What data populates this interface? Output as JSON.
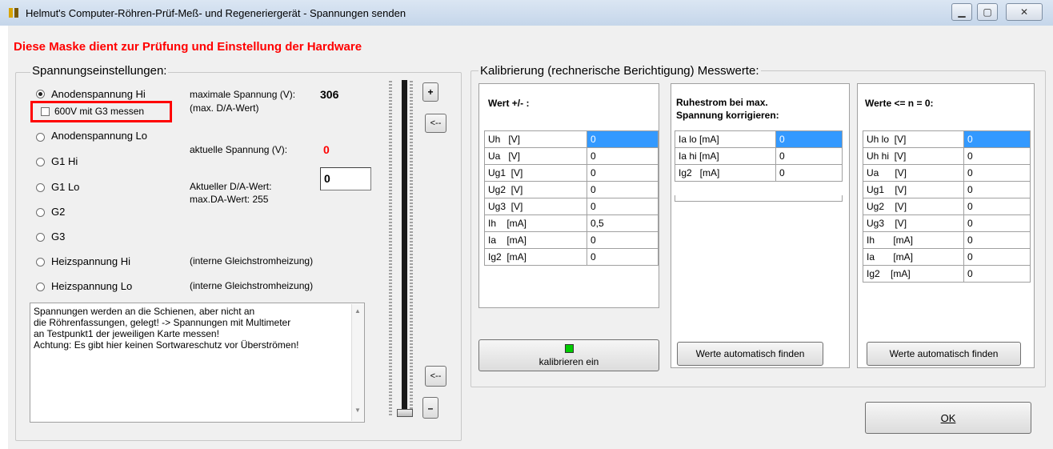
{
  "window": {
    "title": "Helmut's Computer-Röhren-Prüf-Meß- und Regeneriergerät - Spannungen senden",
    "banner": "Diese Maske dient zur Prüfung und Einstellung der Hardware"
  },
  "voltages": {
    "group_title": "Spannungseinstellungen:",
    "options": [
      {
        "label": "Anodenspannung Hi",
        "selected": true
      },
      {
        "label": "Anodenspannung Lo",
        "selected": false
      },
      {
        "label": "G1 Hi",
        "selected": false
      },
      {
        "label": "G1 Lo",
        "selected": false
      },
      {
        "label": "G2",
        "selected": false
      },
      {
        "label": "G3",
        "selected": false
      },
      {
        "label": "Heizspannung Hi",
        "selected": false
      },
      {
        "label": "Heizspannung Lo",
        "selected": false
      }
    ],
    "checkbox_600v": "600V mit G3 messen",
    "max_voltage_label": "maximale Spannung (V):",
    "max_voltage_value": "306",
    "max_da_hint": "(max. D/A-Wert)",
    "current_voltage_label": "aktuelle Spannung (V):",
    "current_voltage_value": "0",
    "current_da_label": "Aktueller D/A-Wert:",
    "current_da_value": "0",
    "max_da_label": "max.DA-Wert: 255",
    "heating_note_hi": "(interne Gleichstromheizung)",
    "heating_note_lo": "(interne Gleichstromheizung)",
    "info_text": [
      "Spannungen werden an die Schienen, aber nicht an",
      "die Röhrenfassungen, gelegt! -> Spannungen mit Multimeter",
      "an Testpunkt1 der jeweiligen Karte messen!",
      "Achtung: Es gibt hier keinen Sortwareschutz vor Überströmen!"
    ],
    "btn_plus": "+",
    "btn_minus": "–",
    "btn_back": "<--",
    "slider_level": 0
  },
  "calibration": {
    "group_title": "Kalibrierung (rechnerische Berichtigung) Messwerte:",
    "panel1": {
      "header": "Wert +/- :",
      "rows": [
        {
          "label": "Uh   [V]",
          "value": "0"
        },
        {
          "label": "Ua   [V]",
          "value": "0"
        },
        {
          "label": "Ug1  [V]",
          "value": "0"
        },
        {
          "label": "Ug2  [V]",
          "value": "0"
        },
        {
          "label": "Ug3  [V]",
          "value": "0"
        },
        {
          "label": "Ih    [mA]",
          "value": "0,5"
        },
        {
          "label": "Ia    [mA]",
          "value": "0"
        },
        {
          "label": "Ig2  [mA]",
          "value": "0"
        }
      ],
      "button": "kalibrieren ein",
      "indicator_color": "#00cc00"
    },
    "panel2": {
      "header_line1": "Ruhestrom bei max.",
      "header_line2": "Spannung korrigieren:",
      "rows": [
        {
          "label": "Ia lo [mA]",
          "value": "0"
        },
        {
          "label": "Ia hi [mA]",
          "value": "0"
        },
        {
          "label": "Ig2   [mA]",
          "value": "0"
        }
      ],
      "button": "Werte automatisch finden"
    },
    "panel3": {
      "header": "Werte <= n = 0:",
      "rows": [
        {
          "label": "Uh lo  [V]",
          "value": "0"
        },
        {
          "label": "Uh hi  [V]",
          "value": "0"
        },
        {
          "label": "Ua      [V]",
          "value": "0"
        },
        {
          "label": "Ug1    [V]",
          "value": "0"
        },
        {
          "label": "Ug2    [V]",
          "value": "0"
        },
        {
          "label": "Ug3    [V]",
          "value": "0"
        },
        {
          "label": "Ih       [mA]",
          "value": "0"
        },
        {
          "label": "Ia       [mA]",
          "value": "0"
        },
        {
          "label": "Ig2    [mA]",
          "value": "0"
        }
      ],
      "button": "Werte automatisch finden"
    }
  },
  "ok_button": "OK",
  "colors": {
    "selection": "#3399ff",
    "highlight_box": "#ff0000",
    "warning_text": "#ff0000"
  }
}
